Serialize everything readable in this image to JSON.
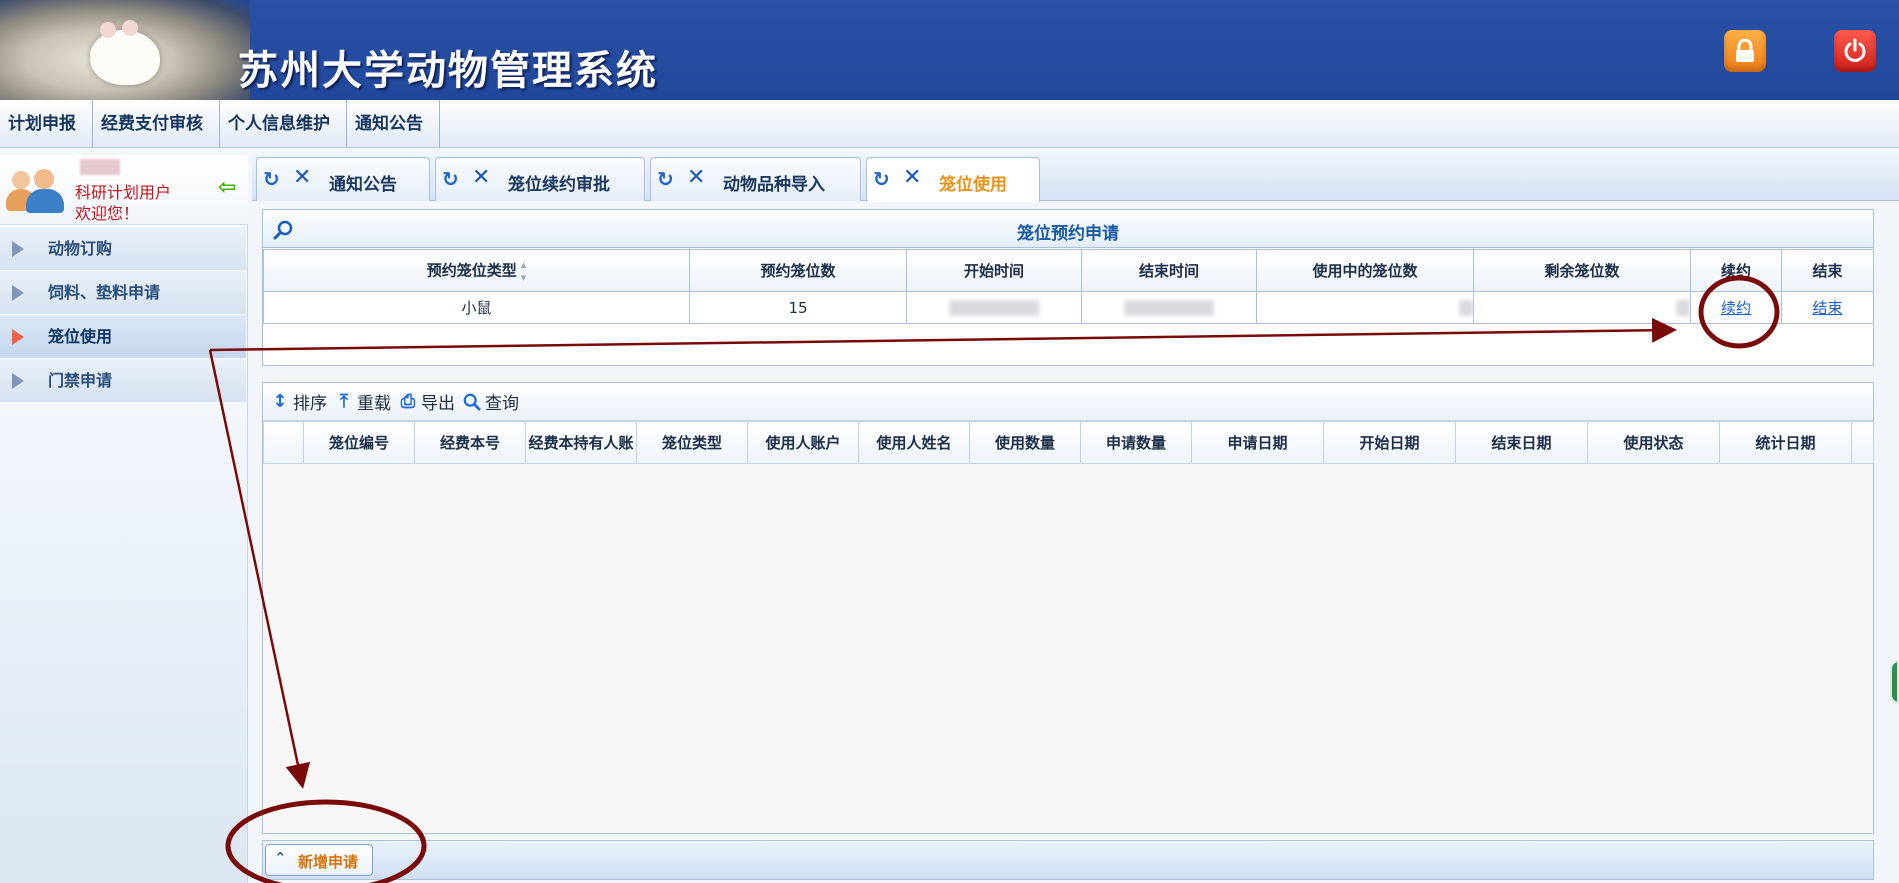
{
  "app": {
    "title": "苏州大学动物管理系统"
  },
  "header": {
    "lock_icon": "lock-icon",
    "power_icon": "power-icon"
  },
  "topnav": {
    "items": [
      "计划申报",
      "经费支付审核",
      "个人信息维护",
      "通知公告"
    ]
  },
  "sidebar": {
    "user_role": "科研计划用户",
    "welcome": "欢迎您！",
    "items": [
      {
        "label": "动物订购"
      },
      {
        "label": "饲料、垫料申请"
      },
      {
        "label": "笼位使用"
      },
      {
        "label": "门禁申请"
      }
    ],
    "active_index": 2
  },
  "tabs": [
    {
      "label": "通知公告"
    },
    {
      "label": "笼位续约审批"
    },
    {
      "label": "动物品种导入"
    },
    {
      "label": "笼位使用"
    }
  ],
  "reservation_panel": {
    "title": "笼位预约申请",
    "columns": [
      "预约笼位类型",
      "预约笼位数",
      "开始时间",
      "结束时间",
      "使用中的笼位数",
      "剩余笼位数",
      "续约",
      "结束"
    ],
    "row": {
      "type": "小鼠",
      "count": "15",
      "renew_link": "续约",
      "end_link": "结束"
    }
  },
  "usage_panel": {
    "toolbar": {
      "sort": "排序",
      "reload": "重载",
      "export": "导出",
      "query": "查询"
    },
    "columns": [
      "笼位编号",
      "经费本号",
      "经费本持有人账",
      "笼位类型",
      "使用人账户",
      "使用人姓名",
      "使用数量",
      "申请数量",
      "申请日期",
      "开始日期",
      "结束日期",
      "使用状态",
      "统计日期"
    ]
  },
  "bottombar": {
    "new_button": "新增申请"
  },
  "colors": {
    "header_blue": "#22489b",
    "accent_orange": "#e89318",
    "annotation_red": "#7a0a0a"
  }
}
